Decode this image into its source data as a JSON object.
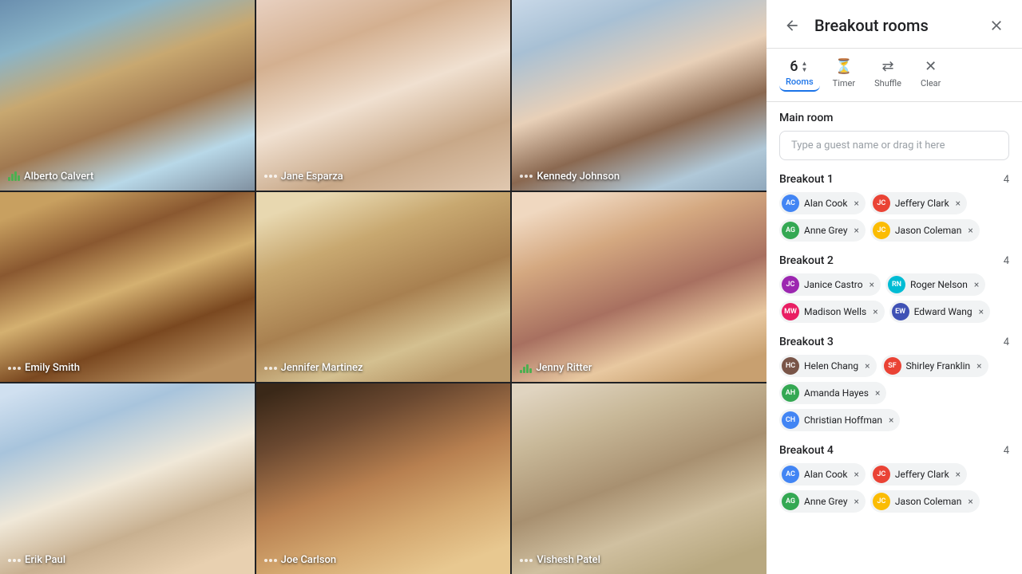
{
  "panel": {
    "title": "Breakout rooms",
    "back_label": "back",
    "close_label": "close",
    "toolbar": {
      "rooms_count": "6",
      "rooms_label": "Rooms",
      "timer_label": "Timer",
      "shuffle_label": "Shuffle",
      "clear_label": "Clear"
    },
    "main_room": {
      "label": "Main room",
      "placeholder": "Type a guest name or drag it here"
    },
    "breakout_rooms": [
      {
        "name": "Breakout 1",
        "count": "4",
        "participants": [
          {
            "name": "Alan Cook",
            "initials": "AC",
            "color": "av-blue"
          },
          {
            "name": "Jeffery Clark",
            "initials": "JC",
            "color": "av-red"
          },
          {
            "name": "Anne Grey",
            "initials": "AG",
            "color": "av-green"
          },
          {
            "name": "Jason Coleman",
            "initials": "JC",
            "color": "av-orange"
          }
        ]
      },
      {
        "name": "Breakout 2",
        "count": "4",
        "participants": [
          {
            "name": "Janice Castro",
            "initials": "JC",
            "color": "av-purple"
          },
          {
            "name": "Roger Nelson",
            "initials": "RN",
            "color": "av-teal"
          },
          {
            "name": "Madison Wells",
            "initials": "MW",
            "color": "av-pink"
          },
          {
            "name": "Edward Wang",
            "initials": "EW",
            "color": "av-indigo"
          }
        ]
      },
      {
        "name": "Breakout 3",
        "count": "4",
        "participants": [
          {
            "name": "Helen Chang",
            "initials": "HC",
            "color": "av-brown"
          },
          {
            "name": "Shirley Franklin",
            "initials": "SF",
            "color": "av-red"
          },
          {
            "name": "Amanda Hayes",
            "initials": "AH",
            "color": "av-green"
          },
          {
            "name": "Christian Hoffman",
            "initials": "CH",
            "color": "av-blue"
          }
        ]
      },
      {
        "name": "Breakout 4",
        "count": "4",
        "participants": [
          {
            "name": "Alan Cook",
            "initials": "AC",
            "color": "av-blue"
          },
          {
            "name": "Jeffery Clark",
            "initials": "JC",
            "color": "av-red"
          },
          {
            "name": "Anne Grey",
            "initials": "AG",
            "color": "av-green"
          },
          {
            "name": "Jason Coleman",
            "initials": "JC",
            "color": "av-orange"
          }
        ]
      }
    ]
  },
  "video_feeds": [
    {
      "name": "Alberto Calvert",
      "mic": "bars",
      "cell_class": "face-1"
    },
    {
      "name": "Jane Esparza",
      "mic": "dots",
      "cell_class": "face-2"
    },
    {
      "name": "Kennedy Johnson",
      "mic": "dots",
      "cell_class": "face-3"
    },
    {
      "name": "Emily Smith",
      "mic": "dots",
      "cell_class": "face-4"
    },
    {
      "name": "Jennifer Martinez",
      "mic": "dots",
      "cell_class": "face-5"
    },
    {
      "name": "Jenny Ritter",
      "mic": "bars",
      "cell_class": "face-6"
    },
    {
      "name": "Erik Paul",
      "mic": "dots",
      "cell_class": "face-7"
    },
    {
      "name": "Joe Carlson",
      "mic": "dots",
      "cell_class": "face-8"
    },
    {
      "name": "Vishesh Patel",
      "mic": "dots",
      "cell_class": "face-9"
    }
  ]
}
